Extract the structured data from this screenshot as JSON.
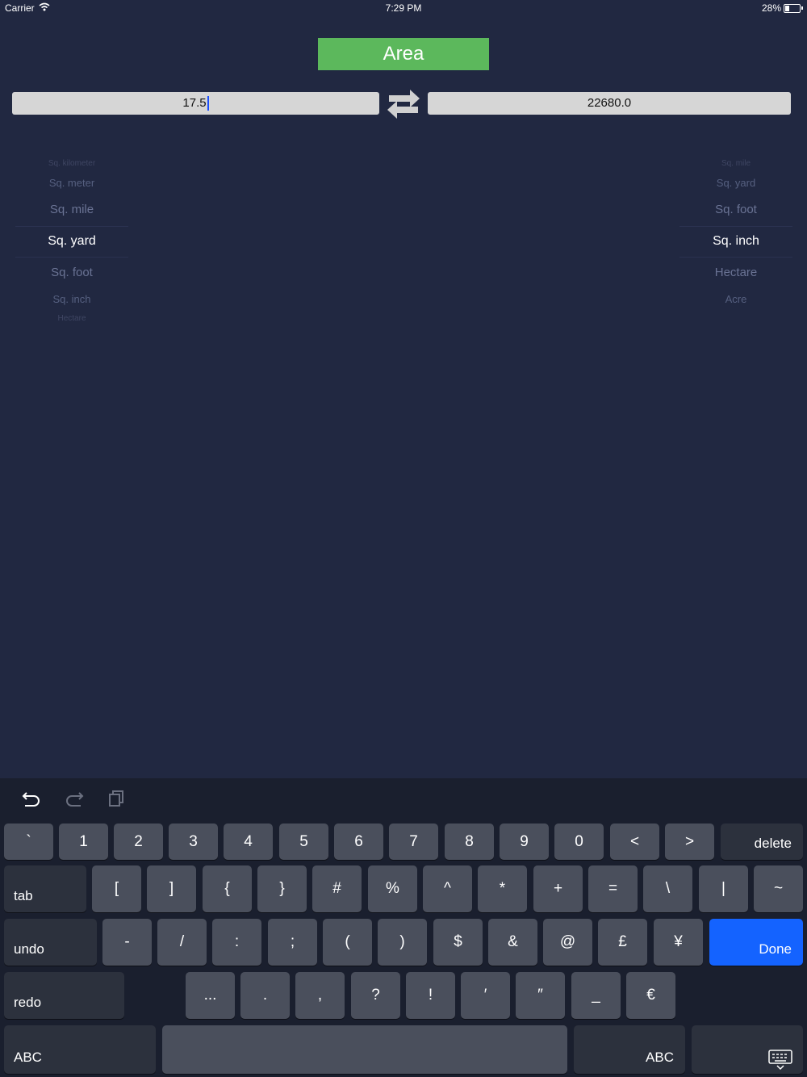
{
  "status_bar": {
    "carrier": "Carrier",
    "time": "7:29 PM",
    "battery": "28%"
  },
  "title": "Area",
  "input": {
    "from_value": "17.5",
    "to_value": "22680.0"
  },
  "left_picker": {
    "items": [
      "Sq. kilometer",
      "Sq. meter",
      "Sq. mile",
      "Sq. yard",
      "Sq. foot",
      "Sq. inch",
      "Hectare"
    ],
    "selected": "Sq. yard"
  },
  "right_picker": {
    "items": [
      "Sq. mile",
      "Sq. yard",
      "Sq. foot",
      "Sq. inch",
      "Hectare",
      "Acre"
    ],
    "selected": "Sq. inch"
  },
  "keyboard": {
    "row1": [
      "`",
      "1",
      "2",
      "3",
      "4",
      "5",
      "6",
      "7",
      "8",
      "9",
      "0",
      "<",
      ">"
    ],
    "delete": "delete",
    "tab": "tab",
    "row2": [
      "[",
      "]",
      "{",
      "}",
      "#",
      "%",
      "^",
      "*",
      "+",
      "=",
      "\\",
      "|",
      "~"
    ],
    "undo": "undo",
    "row3": [
      "-",
      "/",
      ":",
      ";",
      "(",
      ")",
      "$",
      "&",
      "@",
      "£",
      "¥"
    ],
    "done": "Done",
    "redo": "redo",
    "row4": [
      "...",
      ".",
      ",",
      "?",
      "!",
      "′",
      "″",
      "_",
      "€"
    ],
    "abc_left": "ABC",
    "abc_right": "ABC"
  },
  "colors": {
    "background": "#212841",
    "title_button": "#5cb85c",
    "done_key": "#1463ff"
  }
}
